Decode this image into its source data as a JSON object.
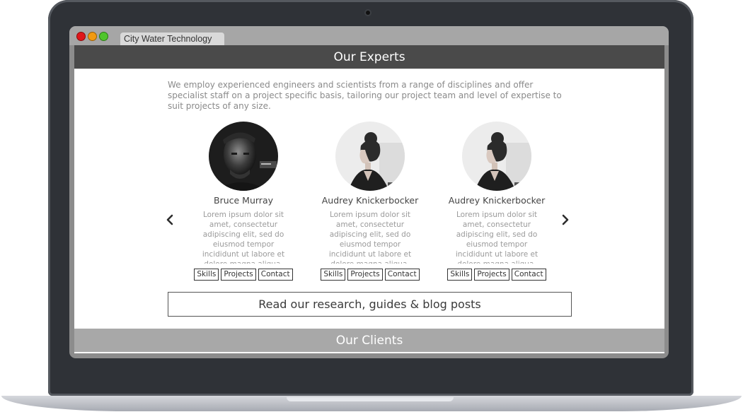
{
  "browser": {
    "tab_title": "City Water Technology"
  },
  "experts": {
    "heading": "Our Experts",
    "intro": "We employ experienced engineers and scientists from a range of disciplines and offer specialist staff on a project specific basis, tailoring our project team and level of expertise to suit projects of any size.",
    "prev_icon": "chevron-left-icon",
    "next_icon": "chevron-right-icon",
    "cards": [
      {
        "name": "Bruce Murray",
        "description": "Lorem ipsum dolor sit amet, consectetur adipiscing elit, sed do eiusmod tempor incididunt ut labore et dolore magna aliqua.",
        "skills": "Skills",
        "projects": "Projects",
        "contact": "Contact"
      },
      {
        "name": "Audrey Knickerbocker",
        "description": "Lorem ipsum dolor sit amet, consectetur adipiscing elit, sed do eiusmod tempor incididunt ut labore et dolore magna aliqua. Ut",
        "skills": "Skills",
        "projects": "Projects",
        "contact": "Contact"
      },
      {
        "name": "Audrey Knickerbocker",
        "description": "Lorem ipsum dolor sit amet, consectetur adipiscing elit, sed do eiusmod tempor incididunt ut labore et dolore magna aliqua. Ut",
        "skills": "Skills",
        "projects": "Projects",
        "contact": "Contact"
      }
    ],
    "cta": "Read our research, guides & blog posts"
  },
  "clients": {
    "heading": "Our Clients"
  },
  "colors": {
    "header_dark": "#4a4a4a",
    "header_light": "#a8a8a8",
    "body_text": "#8a8a8a"
  }
}
